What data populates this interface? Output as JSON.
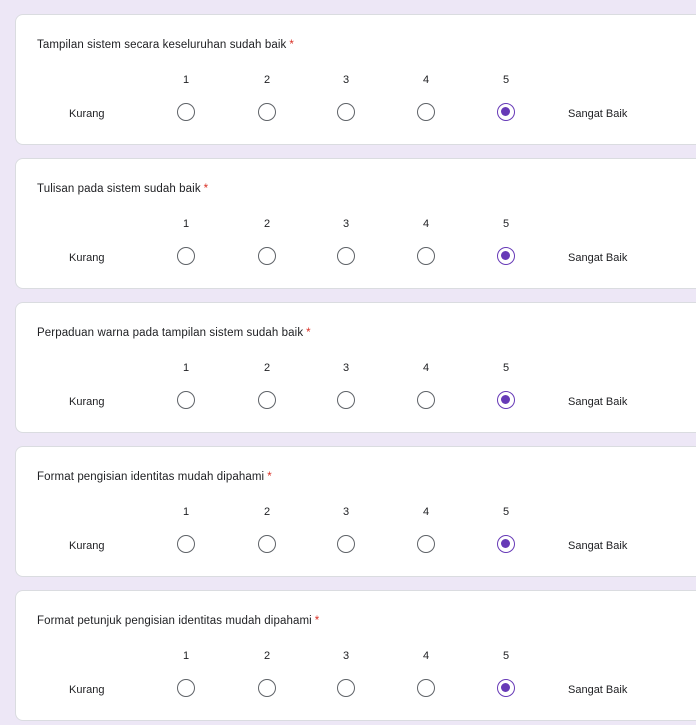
{
  "questions": [
    {
      "title": "Tampilan sistem secara keseluruhan sudah baik",
      "required_mark": "*",
      "scale": [
        "1",
        "2",
        "3",
        "4",
        "5"
      ],
      "low_label": "Kurang",
      "high_label": "Sangat Baik",
      "selected": "5"
    },
    {
      "title": "Tulisan pada sistem sudah baik",
      "required_mark": "*",
      "scale": [
        "1",
        "2",
        "3",
        "4",
        "5"
      ],
      "low_label": "Kurang",
      "high_label": "Sangat Baik",
      "selected": "5"
    },
    {
      "title": "Perpaduan warna pada tampilan sistem sudah baik",
      "required_mark": "*",
      "scale": [
        "1",
        "2",
        "3",
        "4",
        "5"
      ],
      "low_label": "Kurang",
      "high_label": "Sangat Baik",
      "selected": "5"
    },
    {
      "title": "Format pengisian identitas mudah dipahami",
      "required_mark": "*",
      "scale": [
        "1",
        "2",
        "3",
        "4",
        "5"
      ],
      "low_label": "Kurang",
      "high_label": "Sangat Baik",
      "selected": "5"
    },
    {
      "title": "Format petunjuk pengisian identitas mudah dipahami",
      "required_mark": "*",
      "scale": [
        "1",
        "2",
        "3",
        "4",
        "5"
      ],
      "low_label": "Kurang",
      "high_label": "Sangat Baik",
      "selected": "5"
    }
  ],
  "colors": {
    "accent": "#673ab7",
    "required": "#d93025",
    "background": "#ede7f6",
    "card": "#ffffff",
    "unchecked": "#5f6368"
  }
}
